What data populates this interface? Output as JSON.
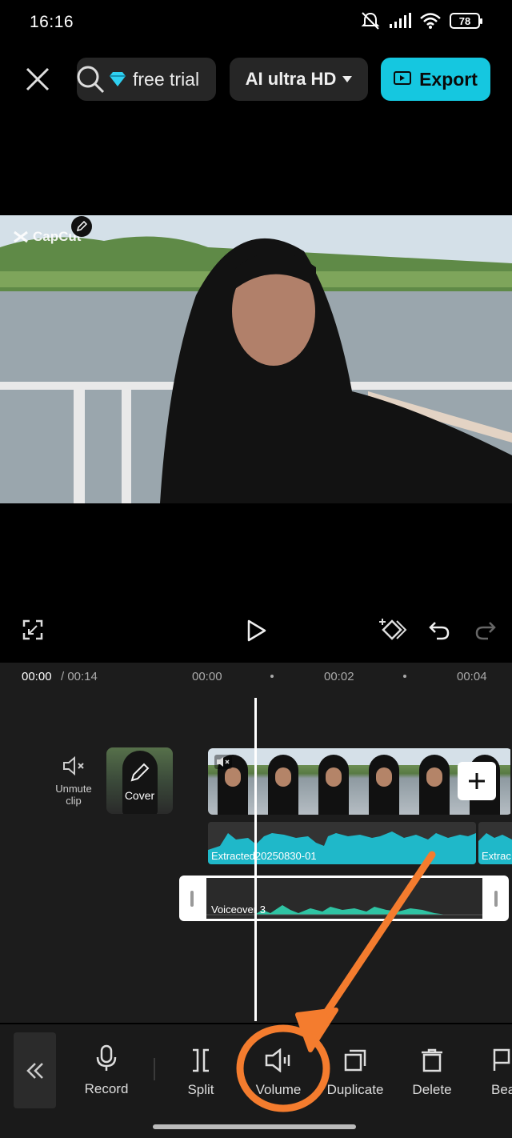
{
  "status_bar": {
    "time": "16:16",
    "battery": "78"
  },
  "top_bar": {
    "trial_label": "free trial",
    "quality_label": "AI ultra HD",
    "export_label": "Export"
  },
  "preview": {
    "watermark": "CapCut"
  },
  "timeline": {
    "current_time": "00:00",
    "total_time": "/ 00:14",
    "ruler": [
      "00:00",
      "00:02",
      "00:04"
    ],
    "unmute_label_1": "Unmute",
    "unmute_label_2": "clip",
    "cover_label": "Cover",
    "audio_label": "Extracted20250830-01",
    "audio_label_2": "Extrac",
    "voiceover_label": "Voiceover 3"
  },
  "toolbar": {
    "items": [
      {
        "label": "Record",
        "icon": "mic-icon"
      },
      {
        "label": "Split",
        "icon": "split-icon"
      },
      {
        "label": "Volume",
        "icon": "volume-icon"
      },
      {
        "label": "Duplicate",
        "icon": "duplicate-icon"
      },
      {
        "label": "Delete",
        "icon": "delete-icon"
      },
      {
        "label": "Bea",
        "icon": "beat-icon"
      }
    ]
  },
  "colors": {
    "accent": "#15c7e0",
    "annotation": "#f47c2e",
    "audio": "#1fb8c9",
    "voice": "#2fc3a3"
  }
}
